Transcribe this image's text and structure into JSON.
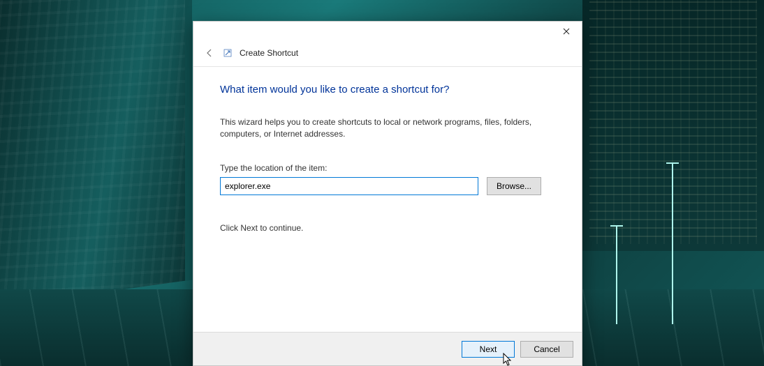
{
  "dialog": {
    "title": "Create Shortcut",
    "heading": "What item would you like to create a shortcut for?",
    "description": "This wizard helps you to create shortcuts to local or network programs, files, folders, computers, or Internet addresses.",
    "location_label": "Type the location of the item:",
    "location_value": "explorer.exe",
    "browse_label": "Browse...",
    "continue_text": "Click Next to continue.",
    "next_label": "Next",
    "cancel_label": "Cancel"
  }
}
